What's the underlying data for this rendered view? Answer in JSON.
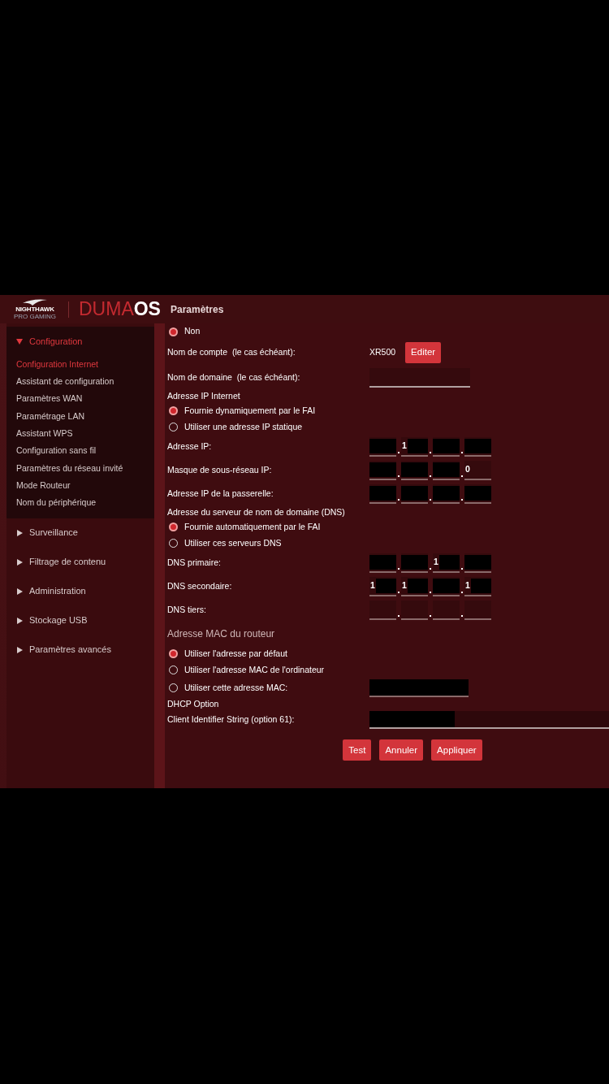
{
  "header": {
    "logo": {
      "name": "NIGHTHAWK",
      "tagline": "PRO GAMING"
    },
    "brand": {
      "light": "DUMA",
      "bold": "OS"
    },
    "title": "Paramètres"
  },
  "sidebar": {
    "items": [
      {
        "label": "Configuration",
        "expanded": true,
        "children": [
          {
            "label": "Configuration Internet",
            "selected": true
          },
          {
            "label": "Assistant de configuration",
            "selected": false
          },
          {
            "label": "Paramètres WAN",
            "selected": false
          },
          {
            "label": "Paramétrage LAN",
            "selected": false
          },
          {
            "label": "Assistant WPS",
            "selected": false
          },
          {
            "label": "Configuration sans fil",
            "selected": false
          },
          {
            "label": "Paramètres du réseau invité",
            "selected": false
          },
          {
            "label": "Mode Routeur",
            "selected": false
          },
          {
            "label": "Nom du périphérique",
            "selected": false
          }
        ]
      },
      {
        "label": "Surveillance",
        "expanded": false
      },
      {
        "label": "Filtrage de contenu",
        "expanded": false
      },
      {
        "label": "Administration",
        "expanded": false
      },
      {
        "label": "Stockage USB",
        "expanded": false
      },
      {
        "label": "Paramètres avancés",
        "expanded": false
      }
    ]
  },
  "form": {
    "rows": [
      {
        "kind": "radio",
        "label": "Non",
        "selected": true
      },
      {
        "kind": "value",
        "label": "Nom de compte  (le cas échéant):",
        "value": "XR500",
        "button": "Editer"
      },
      {
        "kind": "field",
        "label": "Nom de domaine  (le cas échéant):"
      },
      {
        "kind": "heading",
        "label": "Adresse IP Internet"
      },
      {
        "kind": "radio",
        "label": "Fournie dynamiquement par le FAI",
        "selected": true
      },
      {
        "kind": "radio",
        "label": "Utiliser une adresse IP statique",
        "selected": false
      },
      {
        "kind": "ip",
        "label": "Adresse IP:",
        "octets": [
          {
            "redacted": true
          },
          {
            "value": "1",
            "redacted": true
          },
          {
            "redacted": true
          },
          {
            "redacted": true
          }
        ]
      },
      {
        "kind": "ip",
        "label": "Masque de sous-réseau IP:",
        "octets": [
          {
            "redacted": true
          },
          {
            "redacted": true
          },
          {
            "redacted": true
          },
          {
            "value": "0",
            "redacted": false
          }
        ]
      },
      {
        "kind": "ip",
        "label": "Adresse IP de la passerelle:",
        "octets": [
          {
            "redacted": true
          },
          {
            "redacted": true
          },
          {
            "redacted": true
          },
          {
            "redacted": true
          }
        ]
      },
      {
        "kind": "heading",
        "label": "Adresse du serveur de nom de domaine (DNS)"
      },
      {
        "kind": "radio",
        "label": "Fournie automatiquement par le FAI",
        "selected": true
      },
      {
        "kind": "radio",
        "label": "Utiliser ces serveurs DNS",
        "selected": false
      },
      {
        "kind": "ip",
        "label": "DNS primaire:",
        "octets": [
          {
            "redacted": true
          },
          {
            "redacted": true
          },
          {
            "value": "1",
            "redacted": true
          },
          {
            "redacted": true
          }
        ]
      },
      {
        "kind": "ip",
        "label": "DNS secondaire:",
        "octets": [
          {
            "value": "1",
            "redacted": true
          },
          {
            "value": "1",
            "redacted": true
          },
          {
            "redacted": true
          },
          {
            "value": "1",
            "redacted": true
          }
        ]
      },
      {
        "kind": "ip",
        "label": "DNS tiers:",
        "octets": [
          {
            "redacted": false
          },
          {
            "redacted": false
          },
          {
            "redacted": false
          },
          {
            "redacted": false
          }
        ]
      },
      {
        "kind": "section",
        "label": "Adresse MAC du routeur"
      },
      {
        "kind": "radio",
        "label": "Utiliser l'adresse par défaut",
        "selected": true
      },
      {
        "kind": "radio",
        "label": "Utiliser l'adresse MAC de l'ordinateur",
        "selected": false
      },
      {
        "kind": "radio-field",
        "label": "Utiliser cette adresse MAC:",
        "selected": false,
        "redacted": true
      },
      {
        "kind": "heading",
        "label": "DHCP Option"
      },
      {
        "kind": "wide-field",
        "label": "Client Identifier String (option 61):",
        "redacted": true
      }
    ],
    "buttons": [
      "Test",
      "Annuler",
      "Appliquer"
    ]
  }
}
